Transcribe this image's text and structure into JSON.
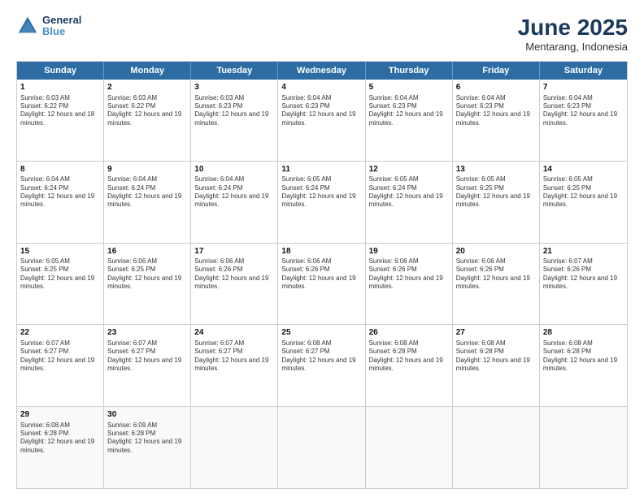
{
  "logo": {
    "line1": "General",
    "line2": "Blue"
  },
  "title": "June 2025",
  "subtitle": "Mentarang, Indonesia",
  "header_days": [
    "Sunday",
    "Monday",
    "Tuesday",
    "Wednesday",
    "Thursday",
    "Friday",
    "Saturday"
  ],
  "weeks": [
    [
      {
        "day": "1",
        "sunrise": "Sunrise: 6:03 AM",
        "sunset": "Sunset: 6:22 PM",
        "daylight": "Daylight: 12 hours and 18 minutes."
      },
      {
        "day": "2",
        "sunrise": "Sunrise: 6:03 AM",
        "sunset": "Sunset: 6:22 PM",
        "daylight": "Daylight: 12 hours and 19 minutes."
      },
      {
        "day": "3",
        "sunrise": "Sunrise: 6:03 AM",
        "sunset": "Sunset: 6:23 PM",
        "daylight": "Daylight: 12 hours and 19 minutes."
      },
      {
        "day": "4",
        "sunrise": "Sunrise: 6:04 AM",
        "sunset": "Sunset: 6:23 PM",
        "daylight": "Daylight: 12 hours and 19 minutes."
      },
      {
        "day": "5",
        "sunrise": "Sunrise: 6:04 AM",
        "sunset": "Sunset: 6:23 PM",
        "daylight": "Daylight: 12 hours and 19 minutes."
      },
      {
        "day": "6",
        "sunrise": "Sunrise: 6:04 AM",
        "sunset": "Sunset: 6:23 PM",
        "daylight": "Daylight: 12 hours and 19 minutes."
      },
      {
        "day": "7",
        "sunrise": "Sunrise: 6:04 AM",
        "sunset": "Sunset: 6:23 PM",
        "daylight": "Daylight: 12 hours and 19 minutes."
      }
    ],
    [
      {
        "day": "8",
        "sunrise": "Sunrise: 6:04 AM",
        "sunset": "Sunset: 6:24 PM",
        "daylight": "Daylight: 12 hours and 19 minutes."
      },
      {
        "day": "9",
        "sunrise": "Sunrise: 6:04 AM",
        "sunset": "Sunset: 6:24 PM",
        "daylight": "Daylight: 12 hours and 19 minutes."
      },
      {
        "day": "10",
        "sunrise": "Sunrise: 6:04 AM",
        "sunset": "Sunset: 6:24 PM",
        "daylight": "Daylight: 12 hours and 19 minutes."
      },
      {
        "day": "11",
        "sunrise": "Sunrise: 6:05 AM",
        "sunset": "Sunset: 6:24 PM",
        "daylight": "Daylight: 12 hours and 19 minutes."
      },
      {
        "day": "12",
        "sunrise": "Sunrise: 6:05 AM",
        "sunset": "Sunset: 6:24 PM",
        "daylight": "Daylight: 12 hours and 19 minutes."
      },
      {
        "day": "13",
        "sunrise": "Sunrise: 6:05 AM",
        "sunset": "Sunset: 6:25 PM",
        "daylight": "Daylight: 12 hours and 19 minutes."
      },
      {
        "day": "14",
        "sunrise": "Sunrise: 6:05 AM",
        "sunset": "Sunset: 6:25 PM",
        "daylight": "Daylight: 12 hours and 19 minutes."
      }
    ],
    [
      {
        "day": "15",
        "sunrise": "Sunrise: 6:05 AM",
        "sunset": "Sunset: 6:25 PM",
        "daylight": "Daylight: 12 hours and 19 minutes."
      },
      {
        "day": "16",
        "sunrise": "Sunrise: 6:06 AM",
        "sunset": "Sunset: 6:25 PM",
        "daylight": "Daylight: 12 hours and 19 minutes."
      },
      {
        "day": "17",
        "sunrise": "Sunrise: 6:06 AM",
        "sunset": "Sunset: 6:26 PM",
        "daylight": "Daylight: 12 hours and 19 minutes."
      },
      {
        "day": "18",
        "sunrise": "Sunrise: 6:06 AM",
        "sunset": "Sunset: 6:26 PM",
        "daylight": "Daylight: 12 hours and 19 minutes."
      },
      {
        "day": "19",
        "sunrise": "Sunrise: 6:06 AM",
        "sunset": "Sunset: 6:26 PM",
        "daylight": "Daylight: 12 hours and 19 minutes."
      },
      {
        "day": "20",
        "sunrise": "Sunrise: 6:06 AM",
        "sunset": "Sunset: 6:26 PM",
        "daylight": "Daylight: 12 hours and 19 minutes."
      },
      {
        "day": "21",
        "sunrise": "Sunrise: 6:07 AM",
        "sunset": "Sunset: 6:26 PM",
        "daylight": "Daylight: 12 hours and 19 minutes."
      }
    ],
    [
      {
        "day": "22",
        "sunrise": "Sunrise: 6:07 AM",
        "sunset": "Sunset: 6:27 PM",
        "daylight": "Daylight: 12 hours and 19 minutes."
      },
      {
        "day": "23",
        "sunrise": "Sunrise: 6:07 AM",
        "sunset": "Sunset: 6:27 PM",
        "daylight": "Daylight: 12 hours and 19 minutes."
      },
      {
        "day": "24",
        "sunrise": "Sunrise: 6:07 AM",
        "sunset": "Sunset: 6:27 PM",
        "daylight": "Daylight: 12 hours and 19 minutes."
      },
      {
        "day": "25",
        "sunrise": "Sunrise: 6:08 AM",
        "sunset": "Sunset: 6:27 PM",
        "daylight": "Daylight: 12 hours and 19 minutes."
      },
      {
        "day": "26",
        "sunrise": "Sunrise: 6:08 AM",
        "sunset": "Sunset: 6:28 PM",
        "daylight": "Daylight: 12 hours and 19 minutes."
      },
      {
        "day": "27",
        "sunrise": "Sunrise: 6:08 AM",
        "sunset": "Sunset: 6:28 PM",
        "daylight": "Daylight: 12 hours and 19 minutes."
      },
      {
        "day": "28",
        "sunrise": "Sunrise: 6:08 AM",
        "sunset": "Sunset: 6:28 PM",
        "daylight": "Daylight: 12 hours and 19 minutes."
      }
    ],
    [
      {
        "day": "29",
        "sunrise": "Sunrise: 6:08 AM",
        "sunset": "Sunset: 6:28 PM",
        "daylight": "Daylight: 12 hours and 19 minutes."
      },
      {
        "day": "30",
        "sunrise": "Sunrise: 6:09 AM",
        "sunset": "Sunset: 6:28 PM",
        "daylight": "Daylight: 12 hours and 19 minutes."
      },
      {
        "day": "",
        "sunrise": "",
        "sunset": "",
        "daylight": ""
      },
      {
        "day": "",
        "sunrise": "",
        "sunset": "",
        "daylight": ""
      },
      {
        "day": "",
        "sunrise": "",
        "sunset": "",
        "daylight": ""
      },
      {
        "day": "",
        "sunrise": "",
        "sunset": "",
        "daylight": ""
      },
      {
        "day": "",
        "sunrise": "",
        "sunset": "",
        "daylight": ""
      }
    ]
  ]
}
